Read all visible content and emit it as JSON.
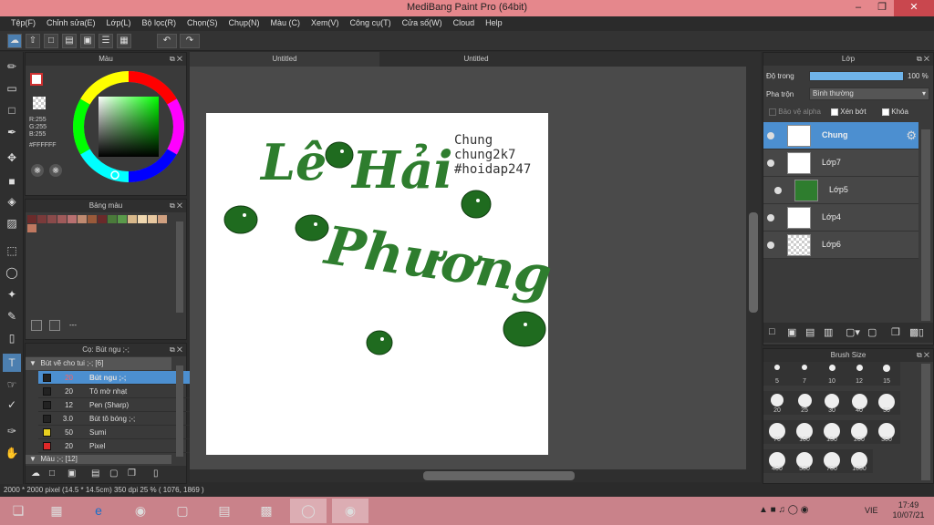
{
  "window": {
    "title": "MediBang Paint Pro (64bit)"
  },
  "menu": [
    "Tệp(F)",
    "Chỉnh sửa(E)",
    "Lớp(L)",
    "Bộ lọc(R)",
    "Chọn(S)",
    "Chụp(N)",
    "Màu (C)",
    "Xem(V)",
    "Công cụ(T)",
    "Cửa số(W)",
    "Cloud",
    "Help"
  ],
  "color_panel": {
    "title": "Màu",
    "r": "R:255",
    "g": "G:255",
    "b": "B:255",
    "hex": "#FFFFFF"
  },
  "palette_panel": {
    "title": "Bảng màu",
    "footer": "---",
    "colors": [
      "#6b2b2b",
      "#7a3a3a",
      "#8a4a4a",
      "#a05a5a",
      "#b87070",
      "#c08a70",
      "#9a5a3a",
      "#6a2a2a",
      "#4a7a3a",
      "#5a9a4a",
      "#d8b88a",
      "#f0d8b0",
      "#e8c8a0",
      "#d0a080",
      "#c07860"
    ]
  },
  "brush_panel": {
    "title": "Cọ: Bút ngu ;-;",
    "group1": "Bút vẽ cho tui ;-; [6]",
    "items": [
      {
        "size": "20",
        "name": "Bút ngu ;-;",
        "color": "#222222"
      },
      {
        "size": "20",
        "name": "Tô mờ nhạt",
        "color": "#222222"
      },
      {
        "size": "12",
        "name": "Pen (Sharp)",
        "color": "#222222"
      },
      {
        "size": "3.0",
        "name": "Bút tô bóng ;-;",
        "color": "#222222"
      },
      {
        "size": "50",
        "name": "Sumi",
        "color": "#e8d020"
      },
      {
        "size": "20",
        "name": "Pixel",
        "color": "#e02828"
      }
    ],
    "group2": "Màu ;-; [12]"
  },
  "tabs": [
    "Untitled",
    "Untitled"
  ],
  "canvas": {
    "text": [
      "Chung",
      "chung2k7",
      "#hoidap247"
    ],
    "script1": "Lê",
    "script2": "Hải",
    "script3": "Phương"
  },
  "layers_panel": {
    "title": "Lớp",
    "opacity_label": "Độ trong",
    "opacity_value": "100 %",
    "blend_label": "Pha trộn",
    "blend_value": "Bình thường",
    "protect_alpha": "Bảo vệ alpha",
    "clipping": "Xén bớt",
    "lock": "Khóa",
    "layers": [
      "Chung",
      "Lớp7",
      "Lớp5",
      "Lớp4",
      "Lớp6"
    ]
  },
  "brush_size_panel": {
    "title": "Brush Size",
    "sizes": [
      "5",
      "7",
      "10",
      "12",
      "15",
      "20",
      "25",
      "30",
      "40",
      "50",
      "70",
      "100",
      "150",
      "200",
      "300",
      "400",
      "500",
      "700",
      "1000"
    ]
  },
  "status": {
    "text": "2000 * 2000 pixel    (14.5 * 14.5cm)    350 dpi    25 %    ( 1076, 1869 )"
  },
  "taskbar": {
    "lang": "VIE",
    "time": "17:49",
    "date": "10/07/21"
  },
  "colors": {
    "accent": "#4c8fd0",
    "titlebar": "#e5878c",
    "taskbar": "#c9828a",
    "ink": "#2e7d2e"
  }
}
